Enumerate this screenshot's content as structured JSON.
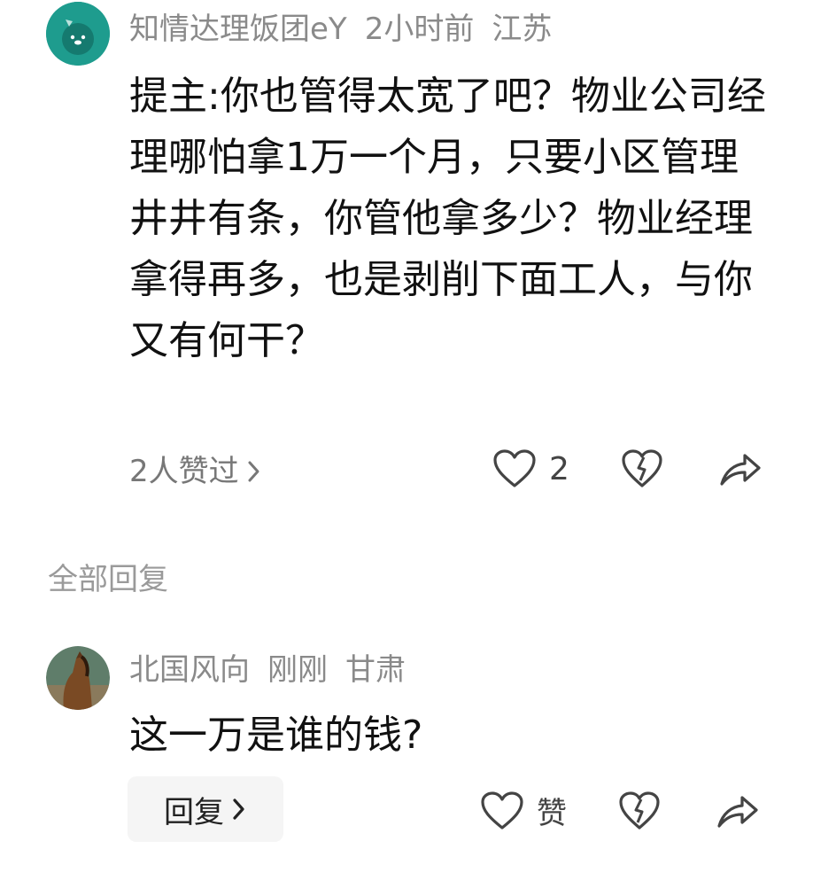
{
  "comment": {
    "username": "知情达理饭团eY",
    "time": "2小时前",
    "location": "江苏",
    "text": "提主:你也管得太宽了吧？物业公司经理哪怕拿1万一个月，只要小区管理井井有条，你管他拿多少？物业经理拿得再多，也是剥削下面工人，与你又有何干？",
    "likers_text": "2人赞过",
    "like_count": "2"
  },
  "section_title": "全部回复",
  "reply": {
    "username": "北国风向",
    "time": "刚刚",
    "location": "甘肃",
    "text": "这一万是谁的钱?",
    "reply_button_label": "回复",
    "like_label": "赞"
  },
  "colors": {
    "avatar_teal": "#1e9c8e",
    "meta_gray": "#8a8a8a",
    "reply_bg": "#f5f5f5"
  },
  "icons": [
    "heart-outline-icon",
    "broken-heart-icon",
    "share-arrow-icon",
    "chevron-right-icon"
  ]
}
